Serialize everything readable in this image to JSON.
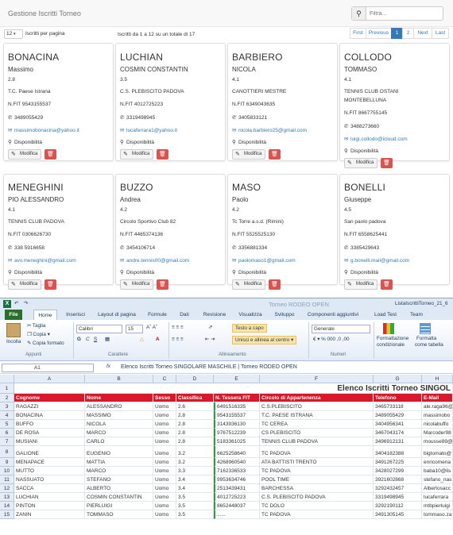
{
  "app": {
    "title": "Gestione Iscritti Torneo",
    "search_placeholder": "Filtra..."
  },
  "listing": {
    "per_page_value": "12",
    "per_page_label": "Iscritti per pagina",
    "info": "Iscritti da 1 a 12 su un totale di 17"
  },
  "pagination": [
    "First",
    "Previous",
    "1",
    "2",
    "Next",
    "Last"
  ],
  "labels": {
    "modifica": "Modifica",
    "disponibilita": "Disponibilità"
  },
  "cards": [
    {
      "surname": "BONACINA",
      "name": "Massimo",
      "rank": "2.8",
      "club": "T.C. Paese Istrana",
      "club2": "",
      "fit": "N.FIT 9543155537",
      "phone": "3489055429",
      "email": "massimobonacina@yahoo.it"
    },
    {
      "surname": "LUCHIAN",
      "name": "COSMIN CONSTANTIN",
      "rank": "3.5",
      "club": "C.S. PLEBISCITO PADOVA",
      "club2": "",
      "fit": "N.FIT 4012725223",
      "phone": "3319498945",
      "email": "lucaferrara1@yahoo.it"
    },
    {
      "surname": "BARBIERO",
      "name": "NICOLA",
      "rank": "4.1",
      "club": "CANOTTIERI MESTRE",
      "club2": "",
      "fit": "N.FIT 6349043635",
      "phone": "3405833121",
      "email": "nicola.barbiero25@gmail.com"
    },
    {
      "surname": "COLLODO",
      "name": "TOMMASO",
      "rank": "4.1",
      "club": "TENNIS CLUB OSTANI",
      "club2": "MONTEBELLUNA",
      "fit": "N.FIT 8667755145",
      "phone": "3488273660",
      "email": "luigi.collodo@icloud.com"
    },
    {
      "surname": "MENEGHINI",
      "name": "PIO ALESSANDRO",
      "rank": "4.1",
      "club": "TENNIS CLUB PADOVA",
      "club2": "",
      "fit": "N.FIT 0306626730",
      "phone": "338 5916658",
      "email": "avv.meneghini@gmail.com"
    },
    {
      "surname": "BUZZO",
      "name": "Andrea",
      "rank": "4.2",
      "club": "Circolo Sportivo Club 82",
      "club2": "",
      "fit": "N.FIT 4465374136",
      "phone": "3454106714",
      "email": "andre.tennis00@gmail.com"
    },
    {
      "surname": "MASO",
      "name": "Paolo",
      "rank": "4.2",
      "club": "Tc Torre a.s.d. (Rimini)",
      "club2": "",
      "fit": "N.FIT 5525525130",
      "phone": "3356881334",
      "email": "paolomaso1@gmail.com"
    },
    {
      "surname": "BONELLI",
      "name": "Giuseppe",
      "rank": "4.5",
      "club": "San paolo padova",
      "club2": "",
      "fit": "N.FIT 6558625441",
      "phone": "3385429643",
      "email": "g.bonelli.mail@gmail.com"
    }
  ],
  "excel": {
    "quick_access": "Torneo RODEO OPEN",
    "filename": "ListaIscrittiTorneo_21_6",
    "tabs": [
      "File",
      "Home",
      "Inserisci",
      "Layout di pagina",
      "Formule",
      "Dati",
      "Revisione",
      "Visualizza",
      "Sviluppo",
      "Componenti aggiuntivi",
      "Load Test",
      "Team"
    ],
    "ribbon": {
      "incolla": "Incolla",
      "taglia": "Taglia",
      "copia": "Copia",
      "copia_formato": "Copia formato",
      "appunti": "Appunti",
      "font": "Calibri",
      "size": "15",
      "carattere": "Carattere",
      "testo_capo": "Testo a capo",
      "unisci": "Unisci e allinea al centro",
      "allineamento": "Allineamento",
      "generale": "Generale",
      "numeri": "Numeri",
      "formattazione": "Formattazione",
      "condizionale": "condizionale",
      "formatta": "Formatta",
      "come_tabella": "come tabella"
    },
    "cell_ref": "A1",
    "formula": "Elenco Iscritti Torneo SINGOLARE MASCHILE | Torneo RODEO OPEN",
    "columns": [
      "A",
      "B",
      "C",
      "D",
      "E",
      "F",
      "G",
      "H"
    ],
    "title_cell": "Elenco Iscritti Torneo SINGOL",
    "headers": [
      "Cognome",
      "Nome",
      "Sesso",
      "Classifica",
      "N. Tessera FIT",
      "Circolo di Appartenenza",
      "Telefono",
      "E-Mail"
    ],
    "rows": [
      [
        "RAGAZZI",
        "ALESSANDRO",
        "Uomo",
        "2.6",
        "6491516335",
        "C.S.PLEBISCITO",
        "3465733118",
        "ale.raga96@"
      ],
      [
        "BONACINA",
        "MASSIMO",
        "Uomo",
        "2.8",
        "9543155537",
        "T.C. PAESE ISTRANA",
        "3489055429",
        "massimobo"
      ],
      [
        "BUFFO",
        "NICOLA",
        "Uomo",
        "2.8",
        "3143936130",
        "TC CEREA",
        "3404956341",
        "nicolabuffo"
      ],
      [
        "DE ROSA",
        "MARCO",
        "Uomo",
        "2.8",
        "9767512239",
        "CS PLEBISCITO",
        "3467043174",
        "Marcoder98"
      ],
      [
        "MUSIANI",
        "CARLO",
        "Uomo",
        "2.8",
        "5183361025",
        "TENNIS CLUB PADOVA",
        "3496912131",
        "mousse89@"
      ],
      [
        "GALIONE",
        "EUGENIO",
        "Uomo",
        "3.2",
        "6625258640",
        "TC PADOVA",
        "3404182388",
        "bigtomato@"
      ],
      [
        "MENAPACE",
        "MATTIA",
        "Uomo",
        "3.2",
        "4268960540",
        "ATA BATTISTI TRENTO",
        "3491267225",
        "enricomena"
      ],
      [
        "MUTTO",
        "MARCO",
        "Uomo",
        "3.3",
        "7162336533",
        "TC PADOVA",
        "3428027299",
        "baba10@lis"
      ],
      [
        "NASSUATO",
        "STEFANO",
        "Uomo",
        "3.4",
        "9953634746",
        "POOL TIME",
        "3921602868",
        "stefano_nas"
      ],
      [
        "SACCA",
        "ALBERTO",
        "Uomo",
        "3.4",
        "2513439431",
        "BARCHESSA",
        "3292432457",
        "Albertosacc"
      ],
      [
        "LUCHIAN",
        "COSMIN CONSTANTIN",
        "Uomo",
        "3.5",
        "4012725223",
        "C.S. PLEBISCITO PADOVA",
        "3319498945",
        "lucaferrara"
      ],
      [
        "PINTON",
        "PIERLUIGI",
        "Uomo",
        "3.5",
        "8652448037",
        "TC DOLO",
        "3292190112",
        "mtbpierluigi"
      ],
      [
        "ZANIN",
        "TOMMASO",
        "Uomo",
        "3.5",
        "......",
        "TC PADOVA",
        "3491305145",
        "tommaso.za"
      ]
    ]
  },
  "colors": {
    "accent": "#337ab7",
    "danger": "#d9534f",
    "excel_header": "#d9182d",
    "file_tab": "#2a6f2a"
  }
}
